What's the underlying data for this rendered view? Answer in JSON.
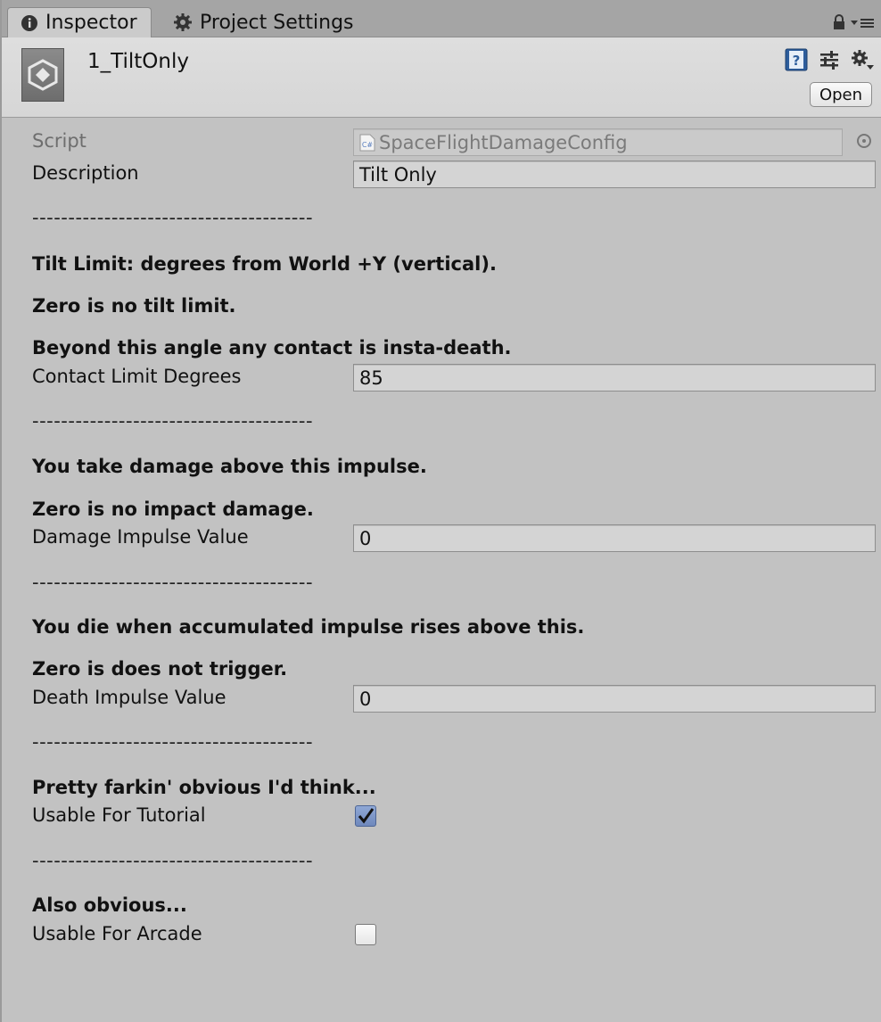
{
  "tabs": [
    {
      "label": "Inspector",
      "icon": "info-icon",
      "active": true
    },
    {
      "label": "Project Settings",
      "icon": "gear-icon",
      "active": false
    }
  ],
  "header": {
    "asset_name": "1_TiltOnly",
    "open_label": "Open"
  },
  "fields": {
    "script": {
      "label": "Script",
      "value": "SpaceFlightDamageConfig"
    },
    "description": {
      "label": "Description",
      "value": "Tilt Only"
    },
    "contact_limit": {
      "label": "Contact Limit Degrees",
      "value": "85"
    },
    "damage_impulse": {
      "label": "Damage Impulse Value",
      "value": "0"
    },
    "death_impulse": {
      "label": "Death Impulse Value",
      "value": "0"
    },
    "usable_tutorial": {
      "label": "Usable For Tutorial",
      "checked": true
    },
    "usable_arcade": {
      "label": "Usable For Arcade",
      "checked": false
    }
  },
  "separator": "---------------------------------------",
  "headings": {
    "tilt_1": "Tilt Limit: degrees from World +Y (vertical).",
    "tilt_2": "Zero is no tilt limit.",
    "tilt_3": "Beyond this angle any contact is insta-death.",
    "damage_1": "You take damage above this impulse.",
    "damage_2": "Zero is no impact damage.",
    "death_1": "You die when accumulated impulse rises above this.",
    "death_2": "Zero is does not trigger.",
    "tutorial_1": "Pretty farkin' obvious I'd think...",
    "arcade_1": "Also obvious..."
  }
}
